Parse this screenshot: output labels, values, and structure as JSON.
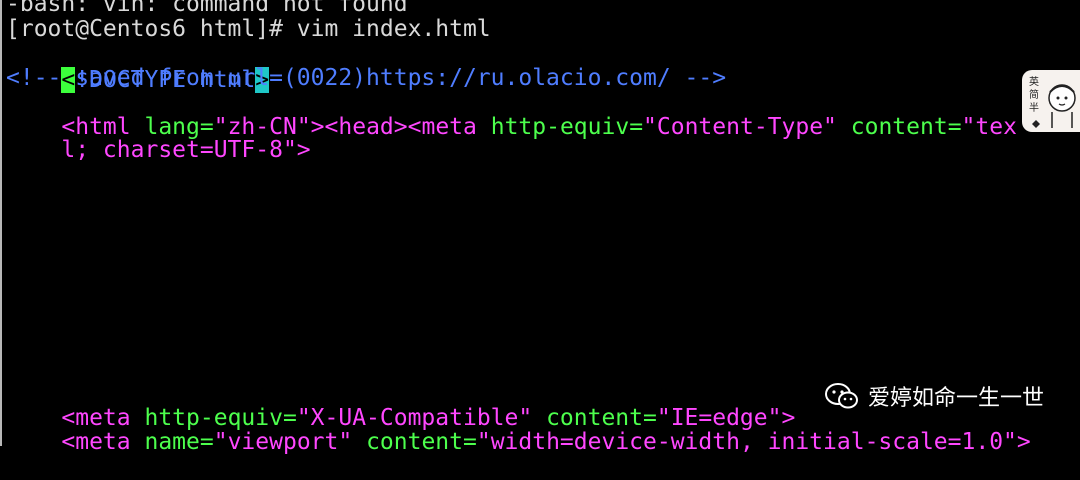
{
  "terminal": {
    "line1": "-bash: vin: command not found",
    "line2": "[root@Centos6 html]# vim index.html",
    "doctype_open": "<",
    "doctype_text": "!DOCTYPE html",
    "doctype_close": ">",
    "comment_line": "<!-- saved from url=(0022)https://ru.olacio.com/ -->",
    "html_tag_open": "<html ",
    "html_lang_attr": "lang=",
    "html_lang_val": "\"zh-CN\"",
    "html_tag_close": ">",
    "head_tag": "<head>",
    "meta_open": "<meta ",
    "meta_attr1": "http-equiv=",
    "meta_val1": "\"Content-Type\"",
    "meta_attr2": " content=",
    "meta_val2_part": "\"tex",
    "wrap_val": "l; charset=UTF-8\"",
    "wrap_close": ">",
    "ua_open": "<meta ",
    "ua_attr1": "http-equiv=",
    "ua_val1": "\"X-UA-Compatible\"",
    "ua_attr2": " content=",
    "ua_val2": "\"IE=edge\"",
    "ua_close": ">",
    "vp_open": "<meta ",
    "vp_attr1": "name=",
    "vp_val1": "\"viewport\"",
    "vp_attr2": " content=",
    "vp_val2": "\"width=device-width, initial-scale=1.0\"",
    "vp_close": ">"
  },
  "sticker": {
    "text": "英简半"
  },
  "watermark": {
    "icon": "wechat-icon",
    "text": "爱婷如命一生一世"
  }
}
